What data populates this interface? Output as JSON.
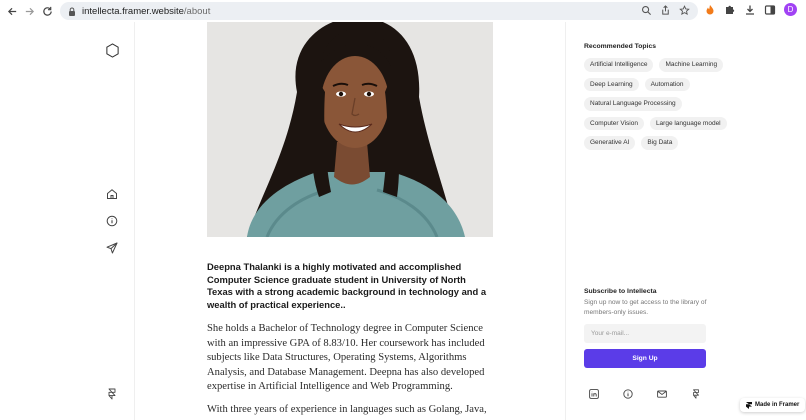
{
  "browser": {
    "url_host": "intellecta.framer.website",
    "url_path": "/about",
    "avatar_letter": "D"
  },
  "article": {
    "intro": "Deepna Thalanki is a highly motivated and accomplished Computer Science graduate student in University of North Texas with a strong academic background in technology and a wealth of practical experience..",
    "para1": " She holds a Bachelor of  Technology degree in Computer Science with an impressive GPA of 8.83/10. Her coursework has included subjects like Data Structures, Operating Systems, Algorithms Analysis, and Database Management. Deepna has also developed expertise in Artificial Intelligence and Web Programming.",
    "para2": "With three years of experience in languages such as Golang, Java,"
  },
  "sidebar": {
    "topics_title": "Recommended Topics",
    "topics": [
      "Artificial Intelligence",
      "Machine Learning",
      "Deep Learning",
      "Automation",
      "Natural Language Processing",
      "Computer Vision",
      "Large language model",
      "Generative AI",
      "Big Data"
    ],
    "subscribe_title": "Subscribe to Intellecta",
    "subscribe_desc": "Sign up now to get access to the library of members-only issues.",
    "email_placeholder": "Your e-mail...",
    "signup_label": "Sign Up"
  },
  "badge": {
    "label": "Made in Framer"
  },
  "colors": {
    "accent": "#5b3ce8",
    "avatar": "#a142f4"
  }
}
